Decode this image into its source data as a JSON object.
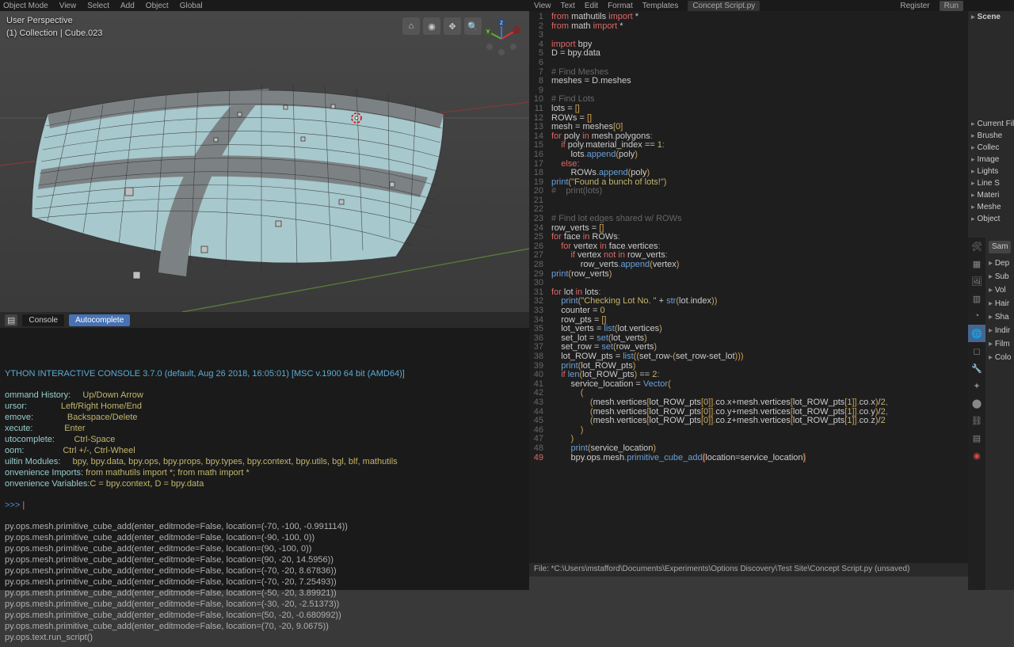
{
  "topbar": {
    "items": [
      "Object Mode",
      "View",
      "Select",
      "Add",
      "Object",
      "Global"
    ],
    "right": [
      "View",
      "Text",
      "Edit",
      "Format",
      "Templates",
      "Concept Script.py",
      "Register",
      "Run"
    ]
  },
  "viewport": {
    "line1": "User Perspective",
    "line2": "(1) Collection | Cube.023"
  },
  "console_head": {
    "tabs": [
      "Console",
      "Autocomplete"
    ]
  },
  "console": {
    "banner": "YTHON INTERACTIVE CONSOLE 3.7.0 (default, Aug 26 2018, 16:05:01) [MSC v.1900 64 bit (AMD64)]",
    "help": [
      [
        "ommand History:",
        "Up/Down Arrow"
      ],
      [
        "ursor:",
        "Left/Right Home/End"
      ],
      [
        "emove:",
        "Backspace/Delete"
      ],
      [
        "xecute:",
        "Enter"
      ],
      [
        "utocomplete:",
        "Ctrl-Space"
      ],
      [
        "oom:",
        "Ctrl +/-, Ctrl-Wheel"
      ],
      [
        "uiltin Modules:",
        "bpy, bpy.data, bpy.ops, bpy.props, bpy.types, bpy.context, bpy.utils, bgl, blf, mathutils"
      ],
      [
        "onvenience Imports:",
        "from mathutils import *; from math import *"
      ],
      [
        "onvenience Variables:",
        "C = bpy.context, D = bpy.data"
      ]
    ],
    "prompt": ">>> ",
    "history": [
      "py.ops.mesh.primitive_cube_add(enter_editmode=False, location=(-70, -100, -0.991114))",
      "py.ops.mesh.primitive_cube_add(enter_editmode=False, location=(-90, -100, 0))",
      "py.ops.mesh.primitive_cube_add(enter_editmode=False, location=(90, -100, 0))",
      "py.ops.mesh.primitive_cube_add(enter_editmode=False, location=(90, -20, 14.5956))",
      "py.ops.mesh.primitive_cube_add(enter_editmode=False, location=(-70, -20, 8.67836))",
      "py.ops.mesh.primitive_cube_add(enter_editmode=False, location=(-70, -20, 7.25493))",
      "py.ops.mesh.primitive_cube_add(enter_editmode=False, location=(-50, -20, 3.89921))",
      "py.ops.mesh.primitive_cube_add(enter_editmode=False, location=(-30, -20, -2.51373))",
      "py.ops.mesh.primitive_cube_add(enter_editmode=False, location=(50, -20, -0.680992))",
      "py.ops.mesh.primitive_cube_add(enter_editmode=False, location=(70, -20, 9.0675))",
      "py.ops.text.run_script()"
    ]
  },
  "script_lines": [
    {
      "n": 1,
      "html": "<span class='kw'>from</span> <span class='id'>mathutils</span> <span class='kw'>import</span> <span class='op'>*</span>"
    },
    {
      "n": 2,
      "html": "<span class='kw'>from</span> <span class='id'>math</span> <span class='kw'>import</span> <span class='op'>*</span>"
    },
    {
      "n": 3,
      "html": ""
    },
    {
      "n": 4,
      "html": "<span class='kw'>import</span> <span class='id'>bpy</span>"
    },
    {
      "n": 5,
      "html": "<span class='id'>D</span> <span class='op'>=</span> <span class='id'>bpy</span><span class='pun'>.</span><span class='id'>data</span>"
    },
    {
      "n": 6,
      "html": ""
    },
    {
      "n": 7,
      "html": "<span class='cm'># Find Meshes</span>"
    },
    {
      "n": 8,
      "html": "<span class='id'>meshes</span> <span class='op'>=</span> <span class='id'>D</span><span class='pun'>.</span><span class='id'>meshes</span>"
    },
    {
      "n": 9,
      "html": ""
    },
    {
      "n": 10,
      "html": "<span class='cm'># Find Lots</span>"
    },
    {
      "n": 11,
      "html": "<span class='id'>lots</span> <span class='op'>=</span> <span class='par'>[</span><span class='par'>]</span>"
    },
    {
      "n": 12,
      "html": "<span class='id'>ROWs</span> <span class='op'>=</span> <span class='par'>[</span><span class='par'>]</span>"
    },
    {
      "n": 13,
      "html": "<span class='id'>mesh</span> <span class='op'>=</span> <span class='id'>meshes</span><span class='par'>[</span><span class='num'>0</span><span class='par'>]</span>"
    },
    {
      "n": 14,
      "html": "<span class='kw'>for</span> <span class='id'>poly</span> <span class='kw'>in</span> <span class='id'>mesh</span><span class='pun'>.</span><span class='id'>polygons</span><span class='pun'>:</span>"
    },
    {
      "n": 15,
      "html": "    <span class='kw'>if</span> <span class='id'>poly</span><span class='pun'>.</span><span class='id'>material_index</span> <span class='op'>==</span> <span class='num'>1</span><span class='pun'>:</span>"
    },
    {
      "n": 16,
      "html": "        <span class='id'>lots</span><span class='pun'>.</span><span class='fn'>append</span><span class='par'>(</span><span class='id'>poly</span><span class='par'>)</span>"
    },
    {
      "n": 17,
      "html": "    <span class='kw'>else</span><span class='pun'>:</span>"
    },
    {
      "n": 18,
      "html": "        <span class='id'>ROWs</span><span class='pun'>.</span><span class='fn'>append</span><span class='par'>(</span><span class='id'>poly</span><span class='par'>)</span>"
    },
    {
      "n": 19,
      "html": "<span class='fn'>print</span><span class='par'>(</span><span class='str'>\"Found a bunch of lots!\"</span><span class='par'>)</span>"
    },
    {
      "n": 20,
      "html": "<span class='cm'>#    print(lots)</span>"
    },
    {
      "n": 21,
      "html": ""
    },
    {
      "n": 22,
      "html": ""
    },
    {
      "n": 23,
      "html": "<span class='cm'># Find lot edges shared w/ ROWs</span>"
    },
    {
      "n": 24,
      "html": "<span class='id'>row_verts</span> <span class='op'>=</span> <span class='par'>[</span><span class='par'>]</span>"
    },
    {
      "n": 25,
      "html": "<span class='kw'>for</span> <span class='id'>face</span> <span class='kw'>in</span> <span class='id'>ROWs</span><span class='pun'>:</span>"
    },
    {
      "n": 26,
      "html": "    <span class='kw'>for</span> <span class='id'>vertex</span> <span class='kw'>in</span> <span class='id'>face</span><span class='pun'>.</span><span class='id'>vertices</span><span class='pun'>:</span>"
    },
    {
      "n": 27,
      "html": "        <span class='kw'>if</span> <span class='id'>vertex</span> <span class='kw'>not</span> <span class='kw'>in</span> <span class='id'>row_verts</span><span class='pun'>:</span>"
    },
    {
      "n": 28,
      "html": "            <span class='id'>row_verts</span><span class='pun'>.</span><span class='fn'>append</span><span class='par'>(</span><span class='id'>vertex</span><span class='par'>)</span>"
    },
    {
      "n": 29,
      "html": "<span class='fn'>print</span><span class='par'>(</span><span class='id'>row_verts</span><span class='par'>)</span>"
    },
    {
      "n": 30,
      "html": ""
    },
    {
      "n": 31,
      "html": "<span class='kw'>for</span> <span class='id'>lot</span> <span class='kw'>in</span> <span class='id'>lots</span><span class='pun'>:</span>"
    },
    {
      "n": 32,
      "html": "    <span class='fn'>print</span><span class='par'>(</span><span class='str'>\"Checking Lot No. \"</span> <span class='op'>+</span> <span class='fn'>str</span><span class='par'>(</span><span class='id'>lot</span><span class='pun'>.</span><span class='id'>index</span><span class='par'>)</span><span class='par'>)</span>"
    },
    {
      "n": 33,
      "html": "    <span class='id'>counter</span> <span class='op'>=</span> <span class='num'>0</span>"
    },
    {
      "n": 34,
      "html": "    <span class='id'>row_pts</span> <span class='op'>=</span> <span class='par'>[</span><span class='par'>]</span>"
    },
    {
      "n": 35,
      "html": "    <span class='id'>lot_verts</span> <span class='op'>=</span> <span class='fn'>list</span><span class='par'>(</span><span class='id'>lot</span><span class='pun'>.</span><span class='id'>vertices</span><span class='par'>)</span>"
    },
    {
      "n": 36,
      "html": "    <span class='id'>set_lot</span> <span class='op'>=</span> <span class='fn'>set</span><span class='par'>(</span><span class='id'>lot_verts</span><span class='par'>)</span>"
    },
    {
      "n": 37,
      "html": "    <span class='id'>set_row</span> <span class='op'>=</span> <span class='fn'>set</span><span class='par'>(</span><span class='id'>row_verts</span><span class='par'>)</span>"
    },
    {
      "n": 38,
      "html": "    <span class='id'>lot_ROW_pts</span> <span class='op'>=</span> <span class='fn'>list</span><span class='par'>(</span><span class='par'>(</span><span class='id'>set_row</span><span class='op'>-</span><span class='par'>(</span><span class='id'>set_row</span><span class='op'>-</span><span class='id'>set_lot</span><span class='par'>)</span><span class='par'>)</span><span class='par'>)</span>"
    },
    {
      "n": 39,
      "html": "    <span class='fn'>print</span><span class='par'>(</span><span class='id'>lot_ROW_pts</span><span class='par'>)</span>"
    },
    {
      "n": 40,
      "html": "    <span class='kw'>if</span> <span class='fn'>len</span><span class='par'>(</span><span class='id'>lot_ROW_pts</span><span class='par'>)</span> <span class='op'>==</span> <span class='num'>2</span><span class='pun'>:</span>"
    },
    {
      "n": 41,
      "html": "        <span class='id'>service_location</span> <span class='op'>=</span> <span class='fn'>Vector</span><span class='par'>(</span>"
    },
    {
      "n": 42,
      "html": "            <span class='par'>(</span>"
    },
    {
      "n": 43,
      "html": "                <span class='par'>(</span><span class='id'>mesh</span><span class='pun'>.</span><span class='id'>vertices</span><span class='par'>[</span><span class='id'>lot_ROW_pts</span><span class='par'>[</span><span class='num'>0</span><span class='par'>]</span><span class='par'>]</span><span class='pun'>.</span><span class='id'>co</span><span class='pun'>.</span><span class='id'>x</span><span class='op'>+</span><span class='id'>mesh</span><span class='pun'>.</span><span class='id'>vertices</span><span class='par'>[</span><span class='id'>lot_ROW_pts</span><span class='par'>[</span><span class='num'>1</span><span class='par'>]</span><span class='par'>]</span><span class='pun'>.</span><span class='id'>co</span><span class='pun'>.</span><span class='id'>x</span><span class='par'>)</span><span class='op'>/</span><span class='num'>2</span><span class='pun'>,</span>"
    },
    {
      "n": 44,
      "html": "                <span class='par'>(</span><span class='id'>mesh</span><span class='pun'>.</span><span class='id'>vertices</span><span class='par'>[</span><span class='id'>lot_ROW_pts</span><span class='par'>[</span><span class='num'>0</span><span class='par'>]</span><span class='par'>]</span><span class='pun'>.</span><span class='id'>co</span><span class='pun'>.</span><span class='id'>y</span><span class='op'>+</span><span class='id'>mesh</span><span class='pun'>.</span><span class='id'>vertices</span><span class='par'>[</span><span class='id'>lot_ROW_pts</span><span class='par'>[</span><span class='num'>1</span><span class='par'>]</span><span class='par'>]</span><span class='pun'>.</span><span class='id'>co</span><span class='pun'>.</span><span class='id'>y</span><span class='par'>)</span><span class='op'>/</span><span class='num'>2</span><span class='pun'>,</span>"
    },
    {
      "n": 45,
      "html": "                <span class='par'>(</span><span class='id'>mesh</span><span class='pun'>.</span><span class='id'>vertices</span><span class='par'>[</span><span class='id'>lot_ROW_pts</span><span class='par'>[</span><span class='num'>0</span><span class='par'>]</span><span class='par'>]</span><span class='pun'>.</span><span class='id'>co</span><span class='pun'>.</span><span class='id'>z</span><span class='op'>+</span><span class='id'>mesh</span><span class='pun'>.</span><span class='id'>vertices</span><span class='par'>[</span><span class='id'>lot_ROW_pts</span><span class='par'>[</span><span class='num'>1</span><span class='par'>]</span><span class='par'>]</span><span class='pun'>.</span><span class='id'>co</span><span class='pun'>.</span><span class='id'>z</span><span class='par'>)</span><span class='op'>/</span><span class='num'>2</span>"
    },
    {
      "n": 46,
      "html": "            <span class='par'>)</span>"
    },
    {
      "n": 47,
      "html": "        <span class='par'>)</span>"
    },
    {
      "n": 48,
      "html": "        <span class='fn'>print</span><span class='par'>(</span><span class='id'>service_location</span><span class='par'>)</span>"
    },
    {
      "n": 49,
      "html": "        <span class='id'>bpy</span><span class='pun'>.</span><span class='id'>ops</span><span class='pun'>.</span><span class='id'>mesh</span><span class='pun'>.</span><span class='fn'>primitive_cube_add</span><span class='par hl'>(</span><span class='id'>location</span><span class='op'>=</span><span class='id'>service_location</span><span class='par hl'>)</span>"
    }
  ],
  "footer": "File: *C:\\Users\\mstafford\\Documents\\Experiments\\Options Discovery\\Test Site\\Concept Script.py (unsaved)",
  "outliner_top": "Scene",
  "outliner": [
    "Brushe",
    "Collec",
    "Image",
    "Lights",
    "Line S",
    "Materi",
    "Meshe",
    "Object"
  ],
  "outliner_hdr": "Current Fil",
  "props_input": "Sam",
  "props": [
    "Dep",
    "Sub",
    "Vol",
    "Hair",
    "Sha",
    "Indir",
    "Film",
    "Colo"
  ]
}
